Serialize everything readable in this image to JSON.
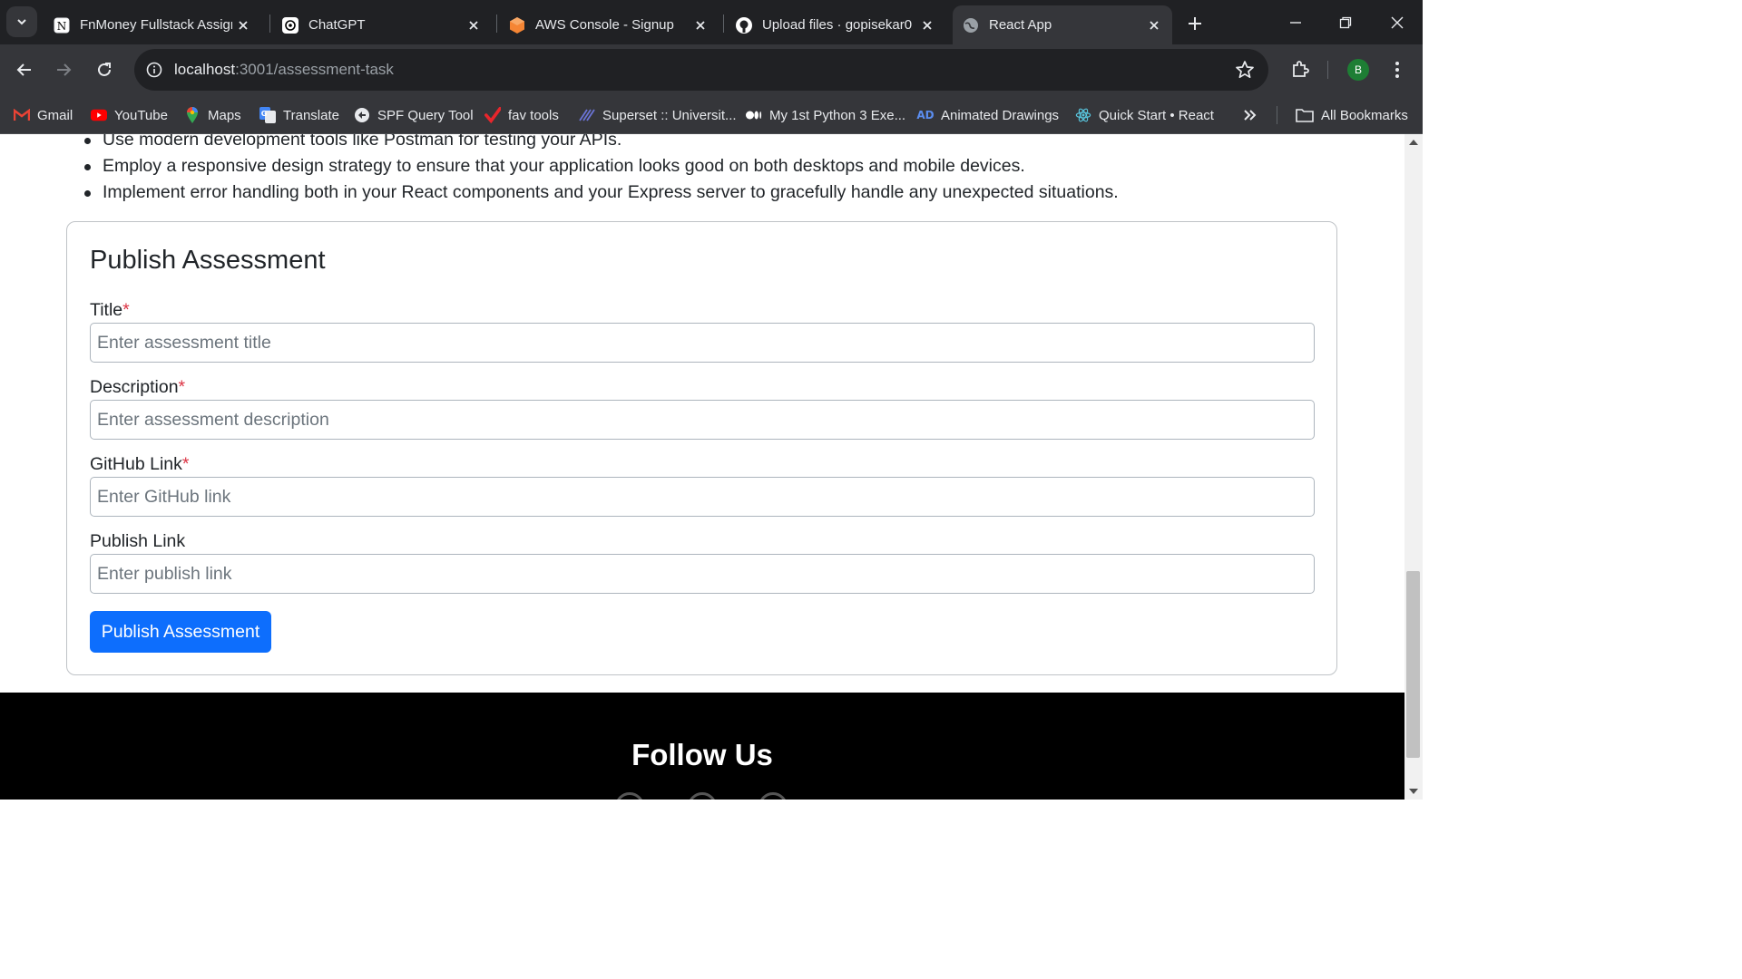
{
  "browser": {
    "tabs": [
      {
        "title": "FnMoney Fullstack Assignment",
        "icon": "notion-icon"
      },
      {
        "title": "ChatGPT",
        "icon": "chatgpt-icon"
      },
      {
        "title": "AWS Console - Signup",
        "icon": "aws-icon"
      },
      {
        "title": "Upload files · gopisekar0",
        "icon": "github-icon"
      },
      {
        "title": "React App",
        "icon": "globe-icon",
        "active": true
      }
    ],
    "address": {
      "host": "localhost",
      "path": ":3001/assessment-task"
    },
    "avatar_letter": "B",
    "bookmarks": [
      {
        "label": "Gmail",
        "icon": "gmail-icon"
      },
      {
        "label": "YouTube",
        "icon": "youtube-icon"
      },
      {
        "label": "Maps",
        "icon": "maps-icon"
      },
      {
        "label": "Translate",
        "icon": "translate-icon"
      },
      {
        "label": "SPF Query Tool",
        "icon": "spf-icon"
      },
      {
        "label": "fav tools",
        "icon": "checkmark-icon"
      },
      {
        "label": "Superset :: Universit...",
        "icon": "superset-icon"
      },
      {
        "label": "My 1st Python 3 Exe...",
        "icon": "medium-icon"
      },
      {
        "label": "Animated Drawings",
        "icon": "ad-icon"
      },
      {
        "label": "Quick Start • React",
        "icon": "react-icon"
      }
    ],
    "all_bookmarks": "All Bookmarks"
  },
  "content": {
    "bullets": [
      "Use modern development tools like Postman for testing your APIs.",
      "Employ a responsive design strategy to ensure that your application looks good on both desktops and mobile devices.",
      "Implement error handling both in your React components and your Express server to gracefully handle any unexpected situations."
    ],
    "form": {
      "heading": "Publish Assessment",
      "fields": [
        {
          "label": "Title",
          "required": "*",
          "placeholder": "Enter assessment title"
        },
        {
          "label": "Description",
          "required": "*",
          "placeholder": "Enter assessment description"
        },
        {
          "label": "GitHub Link",
          "required": "*",
          "placeholder": "Enter GitHub link"
        },
        {
          "label": "Publish Link",
          "required": "",
          "placeholder": "Enter publish link"
        }
      ],
      "submit_label": "Publish Assessment"
    },
    "footer": {
      "heading": "Follow Us"
    }
  },
  "colors": {
    "primary_button": "#0d6efd",
    "required_marker": "#dc3545",
    "footer_bg": "#000000",
    "chrome_dark": "#202124",
    "chrome_toolbar": "#35363a"
  }
}
